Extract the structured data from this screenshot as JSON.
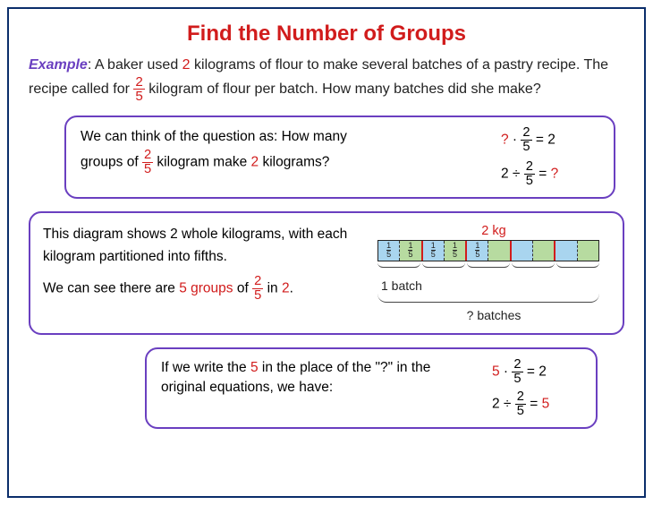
{
  "title": "Find the Number of Groups",
  "example_label": "Example",
  "prompt": {
    "pre": ": A baker used ",
    "qty": "2",
    "mid1": " kilograms of flour to make several batches of a pastry recipe. The recipe called for ",
    "frac_num": "2",
    "frac_den": "5",
    "mid2": "  kilogram of flour per batch. How many batches did she make?"
  },
  "panel1": {
    "line1_pre": "We can think of the question as: How many",
    "line2_pre": "groups of ",
    "frac_num": "2",
    "frac_den": "5",
    "line2_mid": " kilogram make ",
    "qty": "2",
    "line2_post": " kilograms?",
    "eq1": {
      "lhs_q": "?",
      "dot": " · ",
      "num": "2",
      "den": "5",
      "eq": " = ",
      "rhs": "2"
    },
    "eq2": {
      "lhs": "2",
      "div": " ÷ ",
      "num": "2",
      "den": "5",
      "eq": " = ",
      "rhs_q": "?"
    }
  },
  "panel2": {
    "line1": "This diagram shows 2 whole kilograms, with each kilogram partitioned into fifths.",
    "line2_pre": "We can see there are ",
    "count": "5 groups",
    "line2_mid": " of ",
    "frac_num": "2",
    "frac_den": "5",
    "line2_post": " in ",
    "total": "2",
    "line2_end": ".",
    "top_label": "2 kg",
    "batch_label": "1 batch",
    "q_label": "? batches",
    "cell": {
      "num": "1",
      "den": "5"
    }
  },
  "panel3": {
    "line1_pre": "If we write the ",
    "val": "5",
    "line1_mid": " in the place of the \"?\" in the original equations, we have:",
    "eq1": {
      "lhs": "5",
      "dot": " · ",
      "num": "2",
      "den": "5",
      "eq": " = ",
      "rhs": "2"
    },
    "eq2": {
      "lhs": "2",
      "div": " ÷ ",
      "num": "2",
      "den": "5",
      "eq": " = ",
      "rhs": "5"
    }
  },
  "chart_data": {
    "type": "bar",
    "title": "2 kg partitioned into fifths",
    "total_kg": 2,
    "parts_per_kg": 5,
    "cells": [
      {
        "value_label": "1/5",
        "shade": "blue"
      },
      {
        "value_label": "1/5",
        "shade": "green"
      },
      {
        "value_label": "1/5",
        "shade": "blue"
      },
      {
        "value_label": "1/5",
        "shade": "green"
      },
      {
        "value_label": "1/5",
        "shade": "blue"
      },
      {
        "value_label": "",
        "shade": "green"
      },
      {
        "value_label": "",
        "shade": "blue"
      },
      {
        "value_label": "",
        "shade": "green"
      },
      {
        "value_label": "",
        "shade": "blue"
      },
      {
        "value_label": "",
        "shade": "green"
      }
    ],
    "group_size_cells": 2,
    "groups": 5,
    "batch_label": "1 batch",
    "total_label": "2 kg",
    "question_label": "? batches"
  }
}
